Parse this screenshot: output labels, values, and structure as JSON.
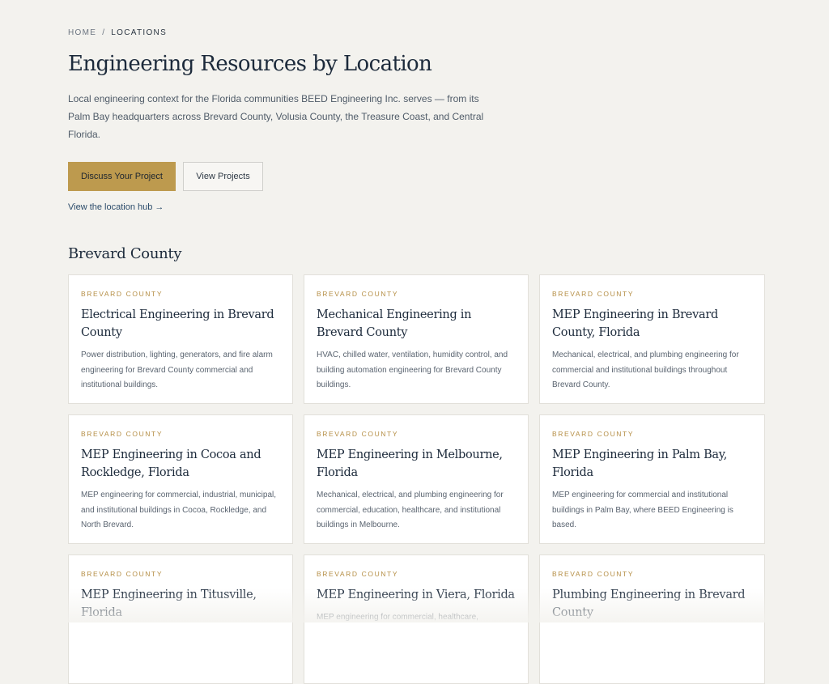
{
  "breadcrumb": {
    "home": "HOME",
    "separator": "/",
    "current": "LOCATIONS"
  },
  "header": {
    "title": "Engineering Resources by Location",
    "intro": "Local engineering context for the Florida communities BEED Engineering Inc. serves — from its Palm Bay headquarters across Brevard County, Volusia County, the Treasure Coast, and Central Florida."
  },
  "actions": {
    "primary_label": "Discuss Your Project",
    "secondary_label": "View Projects",
    "hub_link": "View the location hub →"
  },
  "section": {
    "title": "Brevard County"
  },
  "cards": [
    {
      "tag": "BREVARD COUNTY",
      "title": "Electrical Engineering in Brevard County",
      "description": "Power distribution, lighting, generators, and fire alarm engineering for Brevard County commercial and institutional buildings."
    },
    {
      "tag": "BREVARD COUNTY",
      "title": "Mechanical Engineering in Brevard County",
      "description": "HVAC, chilled water, ventilation, humidity control, and building automation engineering for Brevard County buildings."
    },
    {
      "tag": "BREVARD COUNTY",
      "title": "MEP Engineering in Brevard County, Florida",
      "description": "Mechanical, electrical, and plumbing engineering for commercial and institutional buildings throughout Brevard County."
    },
    {
      "tag": "BREVARD COUNTY",
      "title": "MEP Engineering in Cocoa and Rockledge, Florida",
      "description": "MEP engineering for commercial, industrial, municipal, and institutional buildings in Cocoa, Rockledge, and North Brevard."
    },
    {
      "tag": "BREVARD COUNTY",
      "title": "MEP Engineering in Melbourne, Florida",
      "description": "Mechanical, electrical, and plumbing engineering for commercial, education, healthcare, and institutional buildings in Melbourne."
    },
    {
      "tag": "BREVARD COUNTY",
      "title": "MEP Engineering in Palm Bay, Florida",
      "description": "MEP engineering for commercial and institutional buildings in Palm Bay, where BEED Engineering is based."
    },
    {
      "tag": "BREVARD COUNTY",
      "title": "MEP Engineering in Titusville, Florida",
      "description": ""
    },
    {
      "tag": "BREVARD COUNTY",
      "title": "MEP Engineering in Viera, Florida",
      "description": "MEP engineering for commercial, healthcare,"
    },
    {
      "tag": "BREVARD COUNTY",
      "title": "Plumbing Engineering in Brevard County",
      "description": ""
    }
  ]
}
